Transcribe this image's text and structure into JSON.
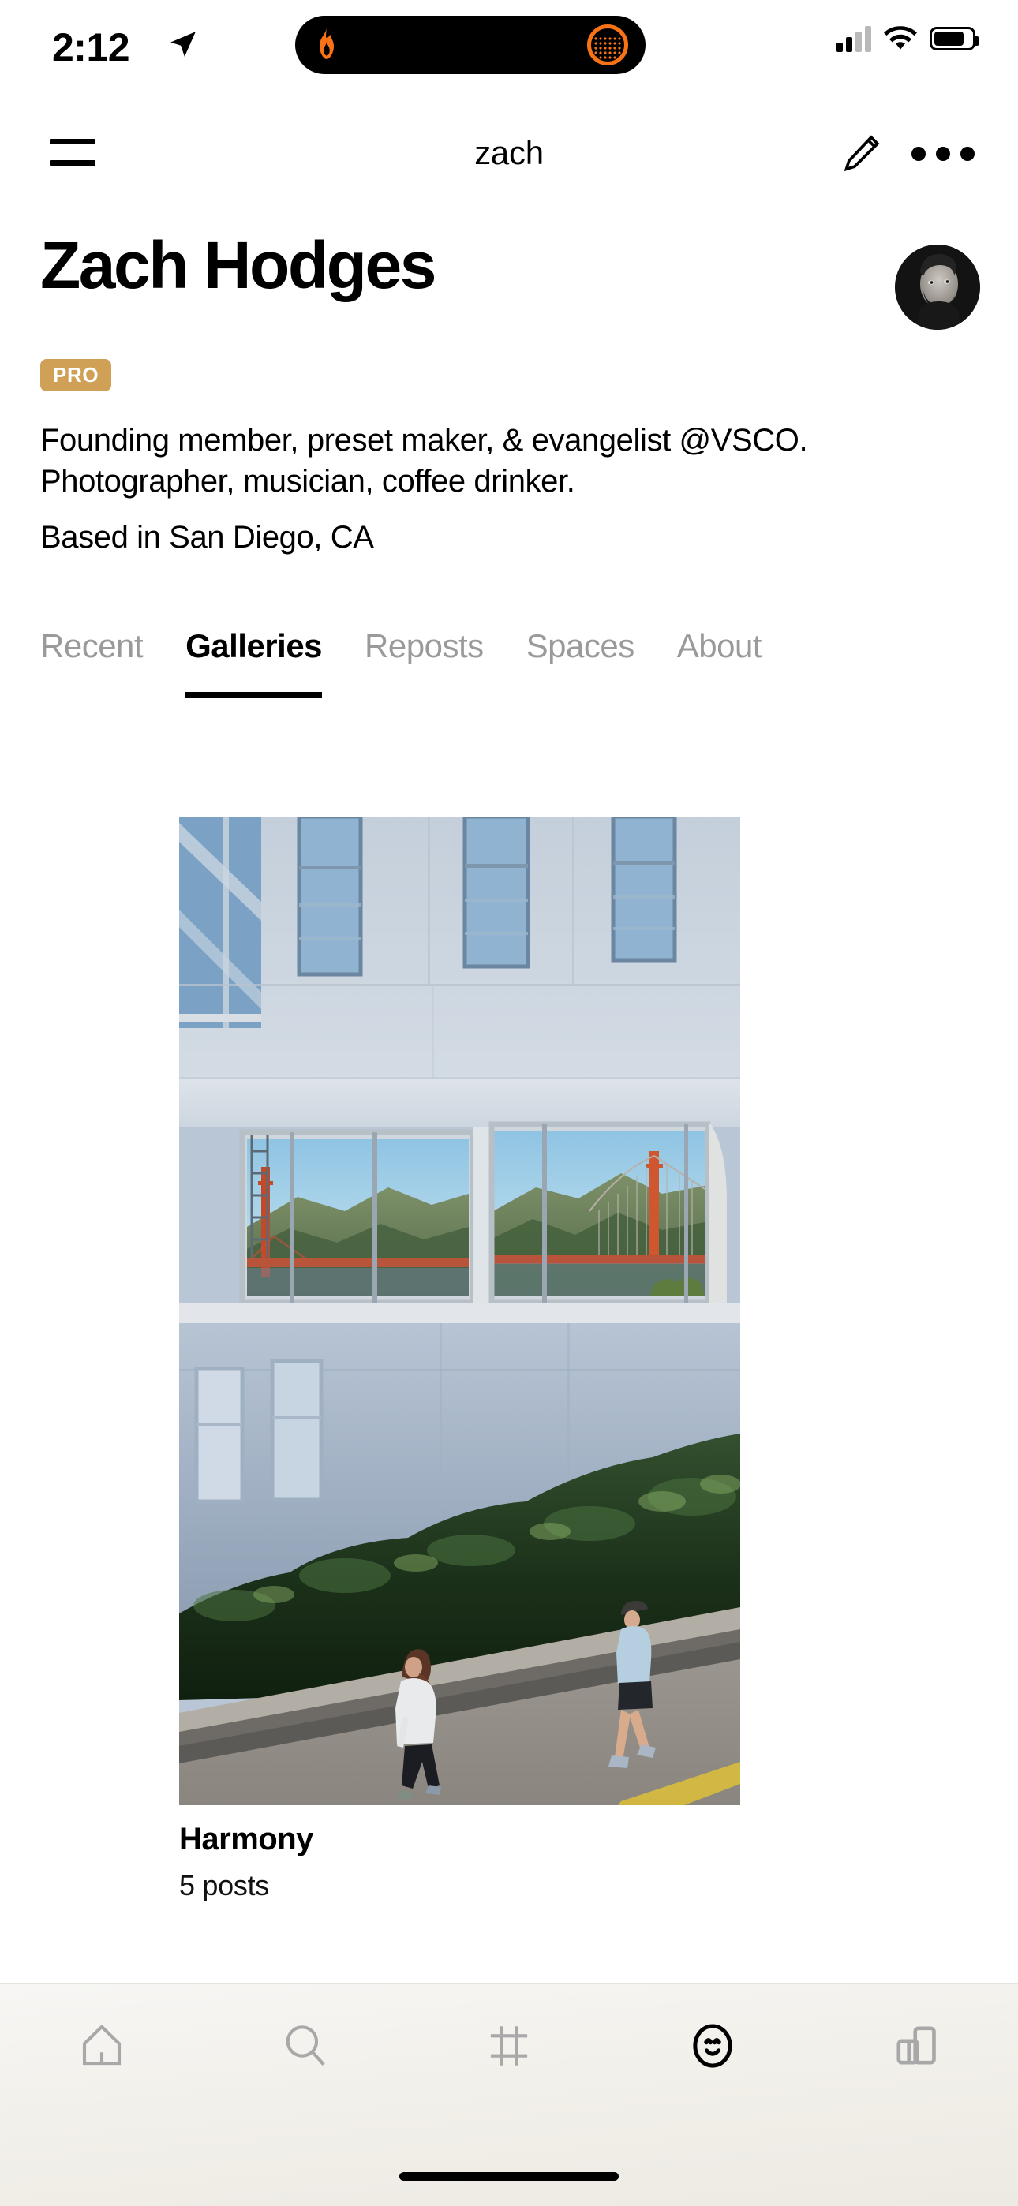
{
  "status_bar": {
    "time": "2:12",
    "location_icon": "location-arrow-icon",
    "dynamic_island": {
      "left_icon": "flame-icon",
      "right_icon": "activity-ring-icon"
    },
    "cellular_icon": "cellular-signal-icon",
    "wifi_icon": "wifi-icon",
    "battery_icon": "battery-icon"
  },
  "nav": {
    "menu_icon": "hamburger-menu-icon",
    "title": "zach",
    "edit_icon": "pencil-edit-icon",
    "more_icon": "more-options-icon"
  },
  "profile": {
    "display_name": "Zach Hodges",
    "avatar_alt": "profile-avatar",
    "badge": "PRO",
    "badge_color": "#CFA055",
    "bio": "Founding member, preset maker, & evangelist @VSCO. Photographer, musician, coffee drinker.",
    "location": "Based in San Diego, CA"
  },
  "tabs": {
    "active": "Galleries",
    "items": [
      {
        "label": "Recent",
        "active": false
      },
      {
        "label": "Galleries",
        "active": true
      },
      {
        "label": "Reposts",
        "active": false
      },
      {
        "label": "Spaces",
        "active": false
      },
      {
        "label": "About",
        "active": false
      }
    ]
  },
  "galleries": [
    {
      "title": "Harmony",
      "post_count": "5 posts",
      "photo_alt": "two-women-walking-past-building-with-golden-gate-bridge-reflection"
    }
  ],
  "tabbar": {
    "items": [
      {
        "name": "home-icon",
        "label": "Home",
        "active": false
      },
      {
        "name": "search-icon",
        "label": "Search",
        "active": false
      },
      {
        "name": "studio-icon",
        "label": "Studio",
        "active": false
      },
      {
        "name": "profile-icon",
        "label": "Profile",
        "active": true
      },
      {
        "name": "spaces-icon",
        "label": "Spaces",
        "active": false
      }
    ],
    "home_indicator": "home-indicator"
  }
}
